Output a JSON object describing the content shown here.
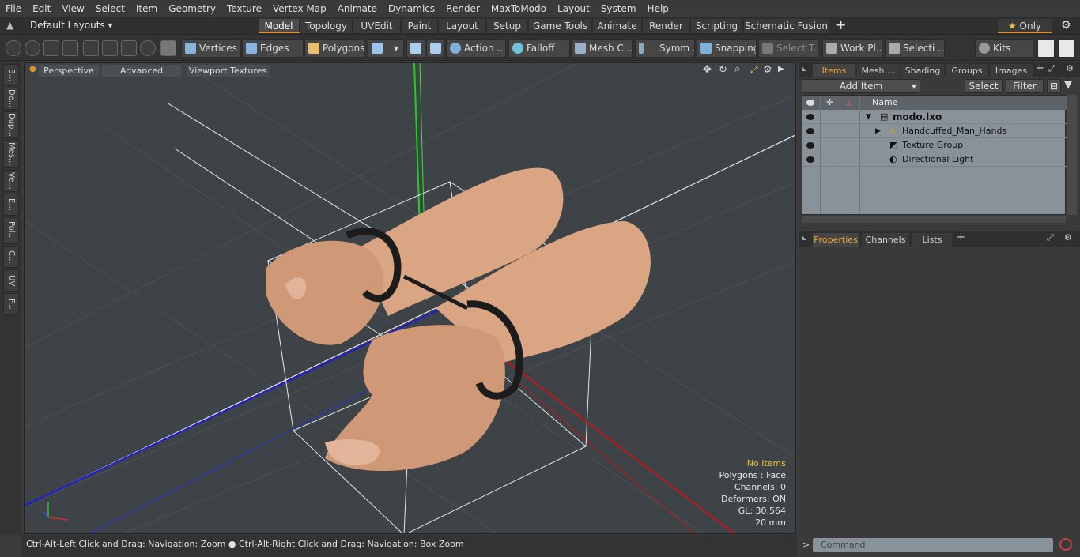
{
  "menu": [
    "File",
    "Edit",
    "View",
    "Select",
    "Item",
    "Geometry",
    "Texture",
    "Vertex Map",
    "Animate",
    "Dynamics",
    "Render",
    "MaxToModo",
    "Layout",
    "System",
    "Help"
  ],
  "layout_selector": "Default Layouts",
  "layout_tabs": [
    "Model",
    "Topology",
    "UVEdit",
    "Paint",
    "Layout",
    "Setup",
    "Game Tools",
    "Animate",
    "Render",
    "Scripting",
    "Schematic Fusion"
  ],
  "active_layout_tab": "Model",
  "only_label": "Only",
  "toolbar": {
    "vertices": "Vertices",
    "edges": "Edges",
    "polygons": "Polygons",
    "action": "Action ...",
    "falloff": "Falloff",
    "mesh": "Mesh C ...",
    "symmetry": "Symm ...",
    "snapping": "Snapping",
    "select_t": "Select T...",
    "work_plane": "Work Pl...",
    "selection": "Selecti ...",
    "kits": "Kits"
  },
  "left_tabs": [
    "B...",
    "De...",
    "Dup...",
    "Mes...",
    "Ve...",
    "E...",
    "Pol...",
    "C...",
    "UV",
    "F..."
  ],
  "viewport": {
    "perspective": "Perspective",
    "advanced": "Advanced",
    "viewport_textures": "Viewport Textures"
  },
  "hud": {
    "no_items": "No Items",
    "polygons": "Polygons : Face",
    "channels": "Channels: 0",
    "deformers": "Deformers: ON",
    "gl": "GL: 30,564",
    "scale": "20 mm"
  },
  "status": "Ctrl-Alt-Left Click and Drag: Navigation: Zoom ● Ctrl-Alt-Right Click and Drag: Navigation: Box Zoom",
  "panel_tabs": [
    "Items",
    "Mesh ...",
    "Shading",
    "Groups",
    "Images"
  ],
  "active_panel_tab": "Items",
  "add_item": "Add Item",
  "select_btn": "Select",
  "filter_btn": "Filter",
  "name_col": "Name",
  "items": [
    {
      "name": "modo.lxo",
      "bold": true
    },
    {
      "name": "Handcuffed_Man_Hands"
    },
    {
      "name": "Texture Group"
    },
    {
      "name": "Directional Light"
    }
  ],
  "lower_tabs": [
    "Properties",
    "Channels",
    "Lists"
  ],
  "command_placeholder": "Command",
  "colors": {
    "accent": "#e0902a",
    "viewport_bg": "#3d4347",
    "skin": "#d9a582"
  }
}
